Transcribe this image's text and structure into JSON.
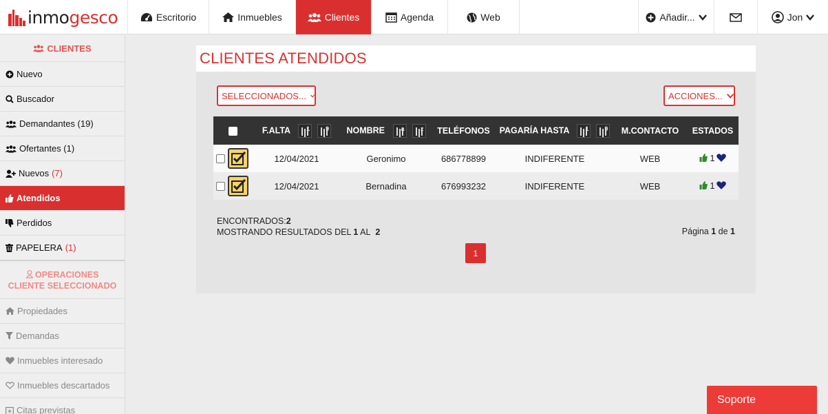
{
  "brand": {
    "part1": "inmo",
    "part2": "gesco"
  },
  "colors": {
    "accent": "#d9302f",
    "soporte": "#ed3b38",
    "checkbox_fill": "#f7d36b",
    "thumb": "#2e8b2e",
    "heart": "#1a237e"
  },
  "nav": {
    "items": [
      {
        "label": "Escritorio",
        "icon": "dashboard-icon"
      },
      {
        "label": "Inmuebles",
        "icon": "home-icon"
      },
      {
        "label": "Clientes",
        "icon": "users-icon"
      },
      {
        "label": "Agenda",
        "icon": "calendar-icon"
      },
      {
        "label": "Web",
        "icon": "globe-icon"
      }
    ],
    "add_label": "Añadir...",
    "user_label": "Jon"
  },
  "sidebar": {
    "heading": "CLIENTES",
    "items": [
      {
        "label": "Nuevo",
        "count": ""
      },
      {
        "label": "Buscador",
        "count": ""
      },
      {
        "label": "Demandantes (19)",
        "count": ""
      },
      {
        "label": "Ofertantes (1)",
        "count": ""
      },
      {
        "label": "Nuevos",
        "count": "(7)"
      },
      {
        "label": "Atendidos",
        "count": ""
      },
      {
        "label": "Perdidos",
        "count": ""
      },
      {
        "label": "PAPELERA",
        "count": "(1)"
      }
    ],
    "ops_heading": "OPERACIONES CLIENTE SELECCIONADO",
    "ops_items": [
      "Propiedades",
      "Demandas",
      "Inmuebles interesado",
      "Inmuebles descartados",
      "Citas previstas"
    ]
  },
  "main": {
    "title": "CLIENTES ATENDIDOS",
    "selected_dropdown": "SELECCIONADOS...",
    "actions_dropdown": "ACCIONES...",
    "table": {
      "headers": {
        "falta": "F.ALTA",
        "nombre": "NOMBRE",
        "telefonos": "TELÉFONOS",
        "pagaria": "PAGARÍA HASTA",
        "mcontacto": "M.CONTACTO",
        "estados": "ESTADOS"
      },
      "rows": [
        {
          "falta": "12/04/2021",
          "nombre": "Geronimo",
          "telefono": "686778899",
          "pagaria": "INDIFERENTE",
          "contacto": "WEB",
          "estado_count": "1"
        },
        {
          "falta": "12/04/2021",
          "nombre": "Bernadina",
          "telefono": "676993232",
          "pagaria": "INDIFERENTE",
          "contacto": "WEB",
          "estado_count": "1"
        }
      ]
    },
    "footer": {
      "found_label": "ENCONTRADOS:",
      "found_value": "2",
      "showing_label": "MOSTRANDO RESULTADOS DEL",
      "showing_from": "1",
      "showing_sep": "AL",
      "showing_to": "2",
      "page_label": "Página",
      "page_current": "1",
      "page_sep": "de",
      "page_total": "1"
    },
    "pagination": [
      "1"
    ]
  },
  "support_label": "Soporte"
}
